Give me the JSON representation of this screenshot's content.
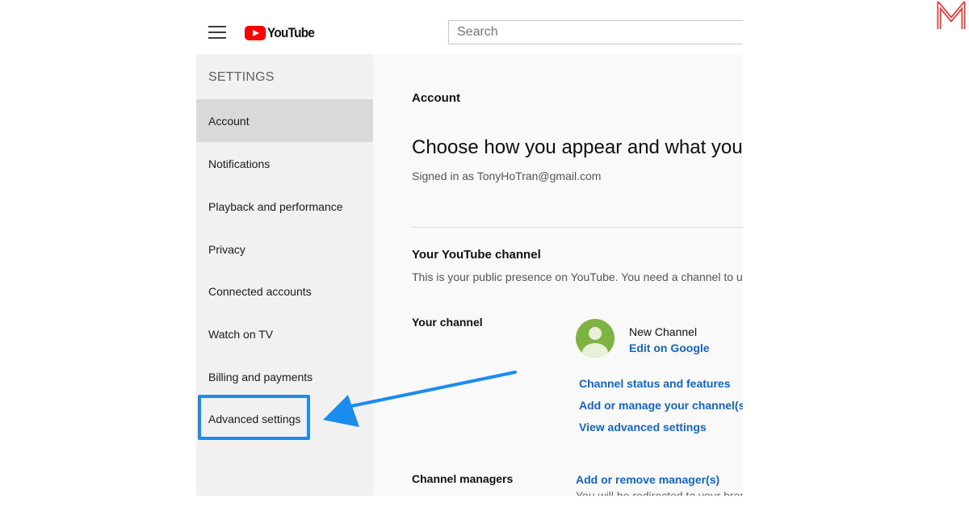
{
  "header": {
    "logo_text": "YouTube",
    "search_placeholder": "Search"
  },
  "sidebar": {
    "title": "SETTINGS",
    "items": [
      {
        "label": "Account",
        "active": true
      },
      {
        "label": "Notifications"
      },
      {
        "label": "Playback and performance"
      },
      {
        "label": "Privacy"
      },
      {
        "label": "Connected accounts"
      },
      {
        "label": "Watch on TV"
      },
      {
        "label": "Billing and payments"
      },
      {
        "label": "Advanced settings",
        "highlighted": true
      }
    ]
  },
  "main": {
    "section_label": "Account",
    "headline": "Choose how you appear and what you se",
    "signed_in": "Signed in as TonyHoTran@gmail.com",
    "channel_heading": "Your YouTube channel",
    "channel_desc": "This is your public presence on YouTube. You need a channel to upload",
    "your_channel_label": "Your channel",
    "channel_name": "New Channel",
    "edit_link": "Edit on Google",
    "links": [
      "Channel status and features",
      "Add or manage your channel(s)",
      "View advanced settings"
    ],
    "managers_label": "Channel managers",
    "managers_link": "Add or remove manager(s)",
    "managers_note": "You will be redirected to your brand"
  },
  "colors": {
    "highlight": "#1a8cf0",
    "link": "#1565c0",
    "brand_red": "#ff0000"
  }
}
